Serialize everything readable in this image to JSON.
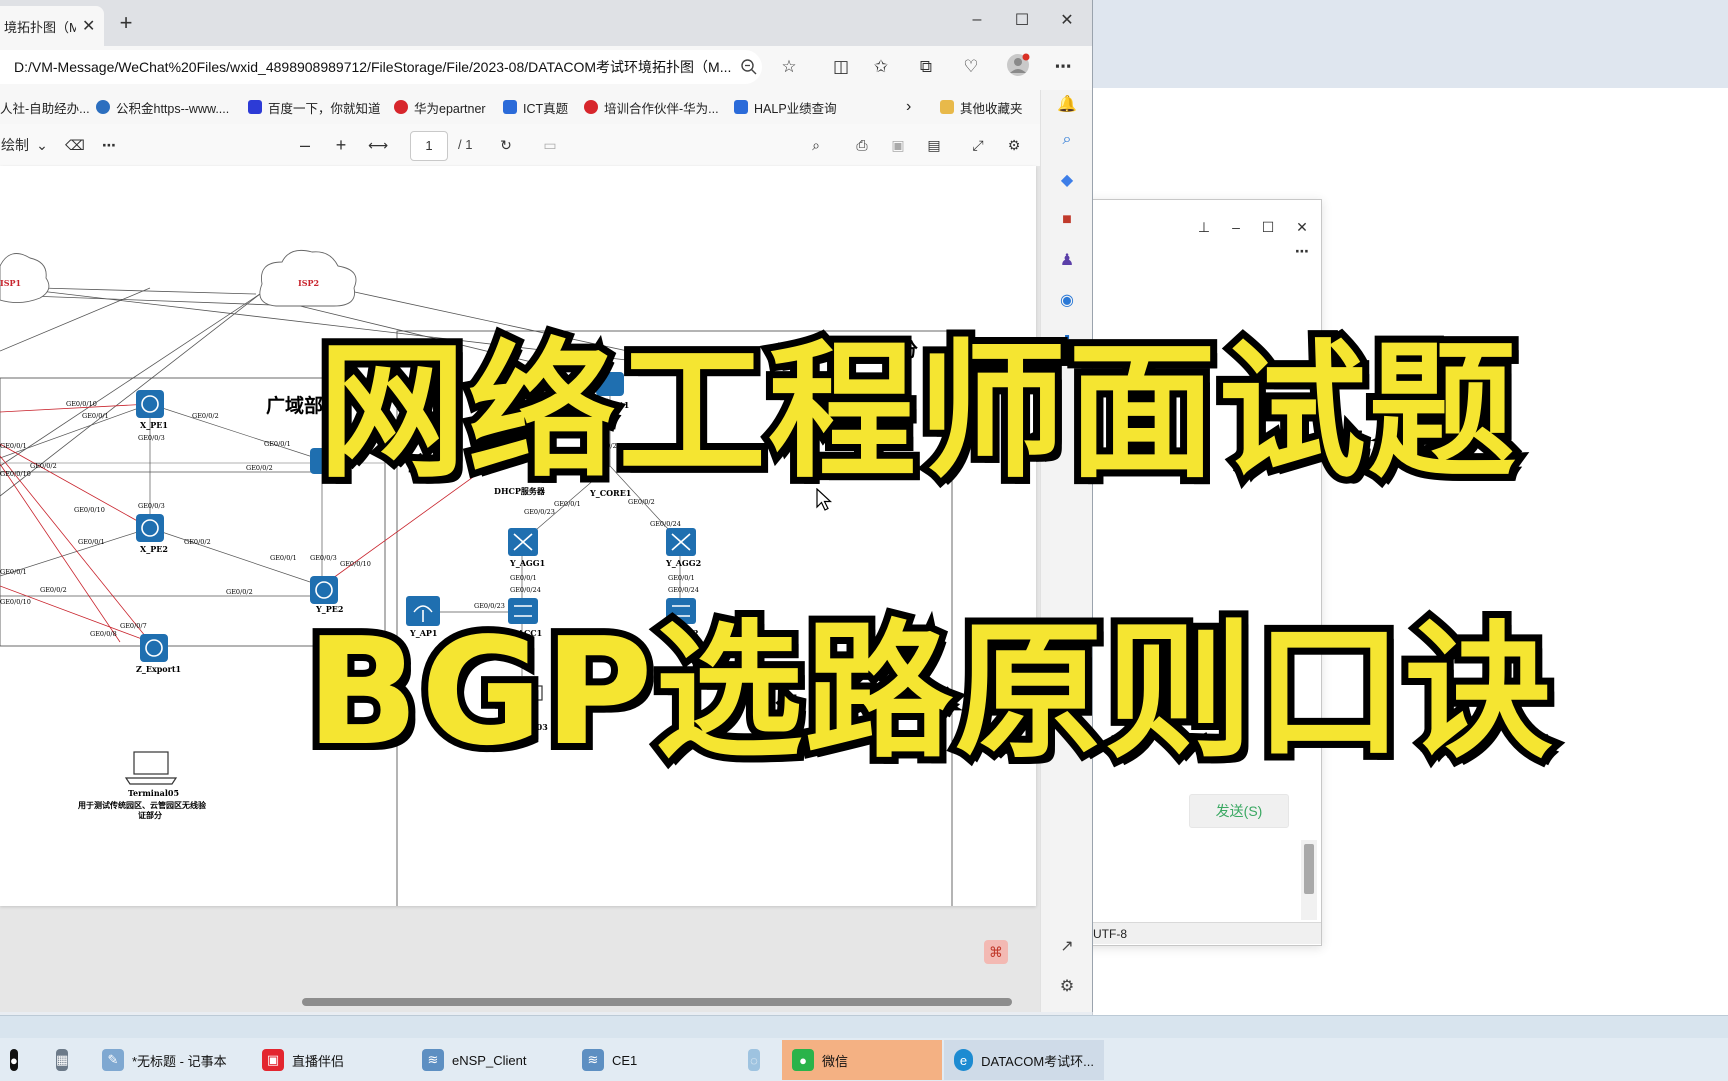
{
  "browser": {
    "tab_title": "境拓扑图（MPL",
    "address": "D:/VM-Message/WeChat%20Files/wxid_4898908989712/FileStorage/File/2023-08/DATACOM考试环境拓扑图（M...",
    "bookmarks": [
      {
        "label": "人社-自助经办...",
        "color": "#6c7a89"
      },
      {
        "label": "公积金https--www....",
        "color": "#2c6fbf"
      },
      {
        "label": "百度一下，你就知道",
        "color": "#2d3bd6"
      },
      {
        "label": "华为epartner",
        "color": "#d7262c"
      },
      {
        "label": "ICT真题",
        "color": "#2b6bd9"
      },
      {
        "label": "培训合作伙伴-华为...",
        "color": "#d7262c"
      },
      {
        "label": "HALP业绩查询",
        "color": "#2b6bd9"
      },
      {
        "label": "其他收藏夹",
        "color": "#e8b94a"
      }
    ],
    "more_bookmarks_icon": "chevron-right-icon"
  },
  "pdf_toolbar": {
    "draw_label": "绘制",
    "page_current": "1",
    "page_total": "/ 1"
  },
  "topology": {
    "clouds": [
      "ISP1",
      "ISP2"
    ],
    "zones": [
      "广域部分",
      "云管部分"
    ],
    "devices": {
      "x_pe1": "X_PE1",
      "x_pe2": "X_PE2",
      "y_pe2": "Y_PE2",
      "z_export1": "Z_Export1",
      "export1": "Export1",
      "y_core1": "Y_CORE1",
      "dhcp": "DHCP服务器",
      "y_agg1": "Y_AGG1",
      "y_agg2": "Y_AGG2",
      "y_acc1": "Y_ACC1",
      "y_acc2": "ACC2",
      "y_ap1": "Y_AP1",
      "terminal103": "inal103",
      "terminal105": "Terminal05",
      "terminal105_note1": "用于测试传统园区、云管园区无线验",
      "terminal105_note2": "证部分"
    },
    "interfaces": {
      "a": "GE0/0/10",
      "b": "GE0/0/1",
      "c": "GE0/0/2",
      "d": "GE0/0/3",
      "e": "GE0/0/24",
      "f": "GE0/0/23",
      "g": "GE0/0/7",
      "h": "GE0/0/8",
      "i": "GE0/0/9"
    }
  },
  "overlay": {
    "line1": "网络工程师面试题",
    "line2": "BGP选路原则口诀"
  },
  "notepad": {
    "encoding": "UTF-8",
    "send_label": "发送(S)"
  },
  "taskbar": {
    "items": [
      {
        "label": "*无标题 - 记事本"
      },
      {
        "label": "直播伴侣"
      },
      {
        "label": "eNSP_Client"
      },
      {
        "label": "CE1"
      },
      {
        "label": "微信"
      },
      {
        "label": "DATACOM考试环..."
      }
    ]
  },
  "colors": {
    "overlay_fill": "#f5e531",
    "device_label": "#c8232c",
    "router_blue": "#1f6fb0",
    "wechat_highlight": "#f4b183"
  }
}
